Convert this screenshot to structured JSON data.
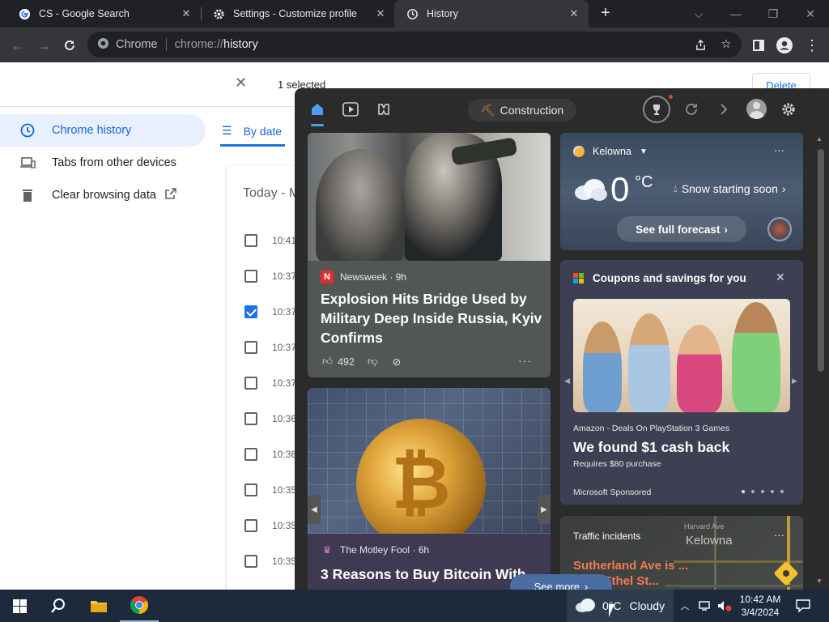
{
  "tabs": [
    {
      "title": "CS - Google Search",
      "icon": "google-icon"
    },
    {
      "title": "Settings - Customize profile",
      "icon": "gear-icon"
    },
    {
      "title": "History",
      "icon": "history-icon",
      "active": true
    }
  ],
  "toolbar": {
    "chip": "Chrome",
    "url_scheme": "chrome://",
    "url_host": "history"
  },
  "history": {
    "selected_text": "1 selected",
    "delete_label": "Delete",
    "nav": [
      {
        "label": "Chrome history",
        "icon": "clock-icon",
        "active": true
      },
      {
        "label": "Tabs from other devices",
        "icon": "devices-icon"
      },
      {
        "label": "Clear browsing data",
        "icon": "trash-icon"
      }
    ],
    "by_date_label": "By date",
    "today_label": "Today - M",
    "rows": [
      {
        "time": "10:41",
        "checked": false
      },
      {
        "time": "10:37",
        "checked": false
      },
      {
        "time": "10:37",
        "checked": true
      },
      {
        "time": "10:37",
        "checked": false
      },
      {
        "time": "10:37",
        "checked": false
      },
      {
        "time": "10:36",
        "checked": false
      },
      {
        "time": "10:36",
        "checked": false
      },
      {
        "time": "10:35",
        "checked": false
      },
      {
        "time": "10:35",
        "checked": false
      },
      {
        "time": "10:35",
        "checked": false
      }
    ]
  },
  "widgets": {
    "topic_chip": "Construction",
    "news1": {
      "source": "Newsweek · 9h",
      "headline": "Explosion Hits Bridge Used by Military Deep Inside Russia, Kyiv Confirms",
      "likes": "492"
    },
    "news2": {
      "source": "The Motley Fool · 6h",
      "headline": "3 Reasons to Buy Bitcoin With"
    },
    "weather": {
      "location": "Kelowna",
      "temp": "0",
      "unit": "°C",
      "condition": "Snow starting soon",
      "forecast_label": "See full forecast"
    },
    "coupons": {
      "title": "Coupons and savings for you",
      "brand": "Amazon - Deals On PlayStation 3 Games",
      "headline": "We found $1 cash back",
      "sub": "Requires $80 purchase",
      "sponsor": "Microsoft Sponsored"
    },
    "traffic": {
      "title": "Traffic incidents",
      "incident": "Sutherland Ave is ... from Ethel St...",
      "city": "Kelowna",
      "street": "Harvard Ave"
    },
    "see_more": "See more"
  },
  "taskbar": {
    "weather_temp": "0°C",
    "weather_text": "Cloudy",
    "time": "10:42 AM",
    "date": "3/4/2024"
  },
  "colors": {
    "accent": "#1a73e8",
    "chrome_dark": "#202124",
    "widgets_bg": "#2b2b2b",
    "taskbar": "#1c2a3c"
  }
}
